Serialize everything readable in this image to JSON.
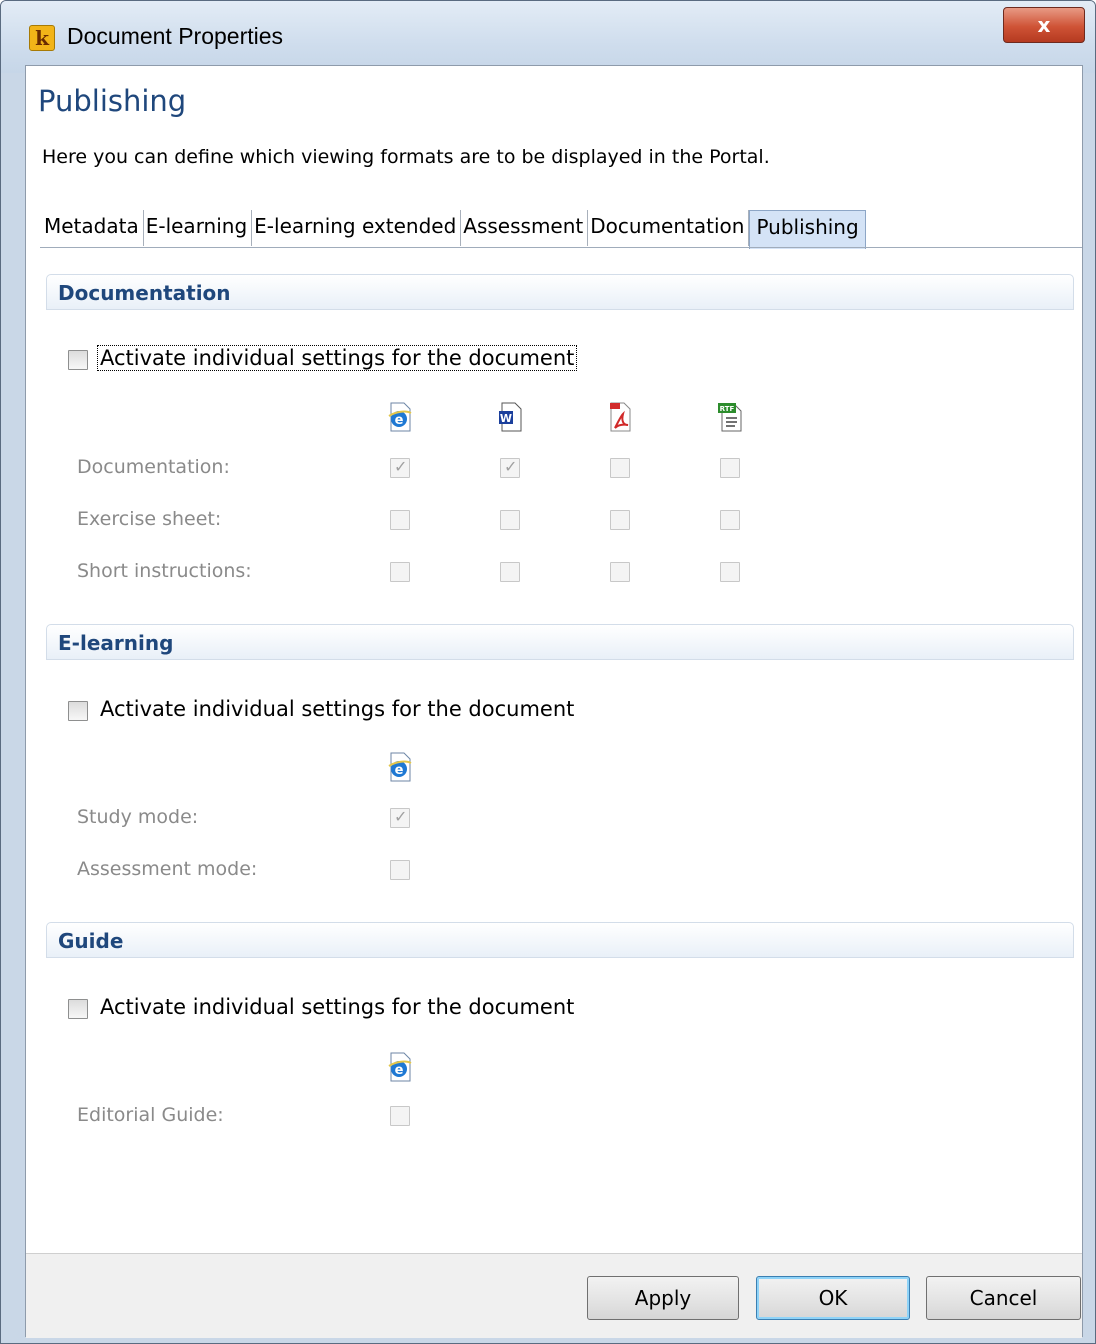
{
  "window": {
    "title": "Document Properties",
    "app_icon_letter": "k",
    "close_glyph": "x"
  },
  "page": {
    "title": "Publishing",
    "description": "Here you can define which viewing formats are to be displayed in the Portal."
  },
  "tabs": [
    {
      "label": "Metadata",
      "active": false
    },
    {
      "label": "E-learning",
      "active": false
    },
    {
      "label": "E-learning extended",
      "active": false
    },
    {
      "label": "Assessment",
      "active": false
    },
    {
      "label": "Documentation",
      "active": false
    },
    {
      "label": "Publishing",
      "active": true
    }
  ],
  "sections": {
    "documentation": {
      "title": "Documentation",
      "activate_label": "Activate individual settings for the document",
      "activate_checked": false,
      "formats": [
        "html-icon",
        "word-icon",
        "pdf-icon",
        "rtf-icon"
      ],
      "rows": [
        {
          "label": "Documentation:",
          "checks": [
            true,
            true,
            false,
            false
          ]
        },
        {
          "label": "Exercise sheet:",
          "checks": [
            false,
            false,
            false,
            false
          ]
        },
        {
          "label": "Short instructions:",
          "checks": [
            false,
            false,
            false,
            false
          ]
        }
      ]
    },
    "elearning": {
      "title": "E-learning",
      "activate_label": "Activate individual settings for the document",
      "activate_checked": false,
      "formats": [
        "html-icon"
      ],
      "rows": [
        {
          "label": "Study mode:",
          "checks": [
            true
          ]
        },
        {
          "label": "Assessment mode:",
          "checks": [
            false
          ]
        }
      ]
    },
    "guide": {
      "title": "Guide",
      "activate_label": "Activate individual settings for the document",
      "activate_checked": false,
      "formats": [
        "html-icon"
      ],
      "rows": [
        {
          "label": "Editorial Guide:",
          "checks": [
            false
          ]
        }
      ]
    }
  },
  "buttons": {
    "apply": "Apply",
    "ok": "OK",
    "cancel": "Cancel"
  },
  "colors": {
    "heading": "#1f477c",
    "active_tab": "#d4e3f6",
    "disabled_text": "#8a8a8a"
  }
}
